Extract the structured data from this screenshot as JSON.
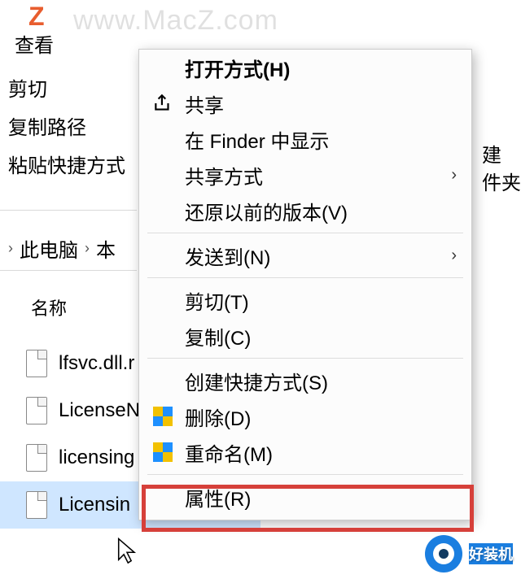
{
  "watermark": "www.MacZ.com",
  "z_icon": "Z",
  "toolbar": {
    "view": "查看"
  },
  "left_actions": {
    "cut": "剪切",
    "copy_path": "复制路径",
    "paste_shortcut": "粘贴快捷方式"
  },
  "right_snippet": {
    "line1": "建",
    "line2": "件夹"
  },
  "breadcrumb": {
    "pc": "此电脑",
    "local": "本"
  },
  "column_header": "名称",
  "files": [
    {
      "name": "lfsvc.dll.r"
    },
    {
      "name": "LicenseN"
    },
    {
      "name": "licensing"
    },
    {
      "name": "Licensin",
      "selected": true
    }
  ],
  "context_menu": {
    "open_with": "打开方式(H)",
    "share": "共享",
    "show_in_finder": "在 Finder 中显示",
    "share_method": "共享方式",
    "restore_previous": "还原以前的版本(V)",
    "send_to": "发送到(N)",
    "cut": "剪切(T)",
    "copy": "复制(C)",
    "create_shortcut": "创建快捷方式(S)",
    "delete": "删除(D)",
    "rename": "重命名(M)",
    "properties": "属性(R)"
  },
  "bottom_brand": "好装机"
}
